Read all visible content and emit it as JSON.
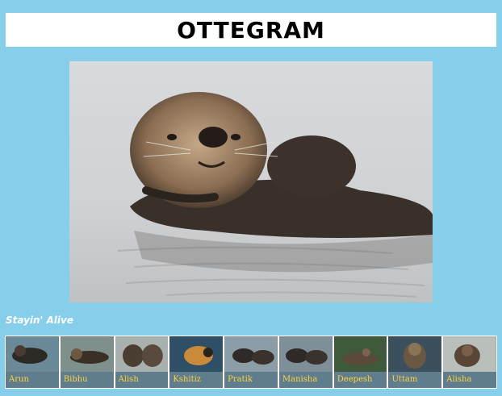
{
  "header": {
    "title": "OTTEGRAM"
  },
  "main": {
    "caption": "Stayin' Alive"
  },
  "thumbnails": [
    {
      "name": "Arun",
      "bg": "#6b8a99",
      "fg": "#2d2a26"
    },
    {
      "name": "Bibhu",
      "bg": "#7e8f8c",
      "fg": "#3b3026"
    },
    {
      "name": "Alish",
      "bg": "#a8b1ae",
      "fg": "#4a3e33"
    },
    {
      "name": "Kshitiz",
      "bg": "#2f4f66",
      "fg": "#c98a3a"
    },
    {
      "name": "Pratik",
      "bg": "#8b9ea8",
      "fg": "#2e2a27"
    },
    {
      "name": "Manisha",
      "bg": "#7f8f98",
      "fg": "#2e2a27"
    },
    {
      "name": "Deepesh",
      "bg": "#3f5a3a",
      "fg": "#5b4a3c"
    },
    {
      "name": "Uttam",
      "bg": "#3b4f5c",
      "fg": "#6b5843"
    },
    {
      "name": "Alisha",
      "bg": "#b9c0bc",
      "fg": "#5a4536"
    }
  ]
}
